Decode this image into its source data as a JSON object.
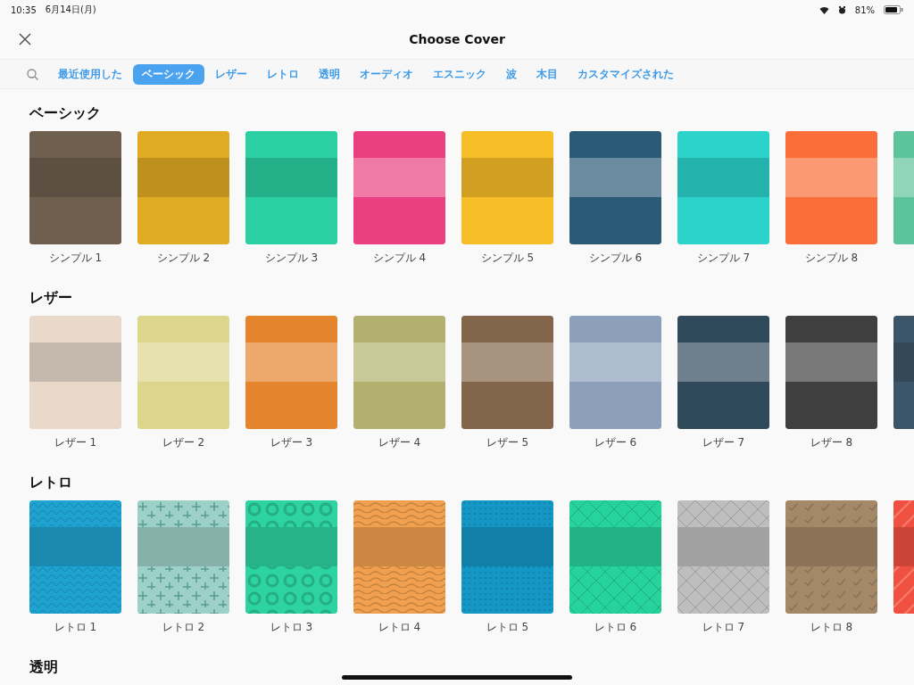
{
  "status_bar": {
    "time": "10:35",
    "date": "6月14日(月)",
    "battery": "81%"
  },
  "header": {
    "title": "Choose Cover"
  },
  "tabs": [
    {
      "label": "最近使用した",
      "selected": false
    },
    {
      "label": "ベーシック",
      "selected": true
    },
    {
      "label": "レザー",
      "selected": false
    },
    {
      "label": "レトロ",
      "selected": false
    },
    {
      "label": "透明",
      "selected": false
    },
    {
      "label": "オーディオ",
      "selected": false
    },
    {
      "label": "エスニック",
      "selected": false
    },
    {
      "label": "波",
      "selected": false
    },
    {
      "label": "木目",
      "selected": false
    },
    {
      "label": "カスタマイズされた",
      "selected": false
    }
  ],
  "sections": [
    {
      "title": "ベーシック",
      "covers": [
        {
          "label": "シンプル 1",
          "color": "#6e5f4f",
          "kind": "dark"
        },
        {
          "label": "シンプル 2",
          "color": "#e0ab24",
          "kind": "dark"
        },
        {
          "label": "シンプル 3",
          "color": "#2bd0a2",
          "kind": "dark"
        },
        {
          "label": "シンプル 4",
          "color": "#ea3f80",
          "kind": "light"
        },
        {
          "label": "シンプル 5",
          "color": "#f6bd26",
          "kind": "dark"
        },
        {
          "label": "シンプル 6",
          "color": "#2b5a77",
          "kind": "light"
        },
        {
          "label": "シンプル 7",
          "color": "#2bd3cb",
          "kind": "dark"
        },
        {
          "label": "シンプル 8",
          "color": "#fb6e3a",
          "kind": "light"
        },
        {
          "color": "#5dc39d",
          "kind": "light"
        }
      ]
    },
    {
      "title": "レザー",
      "covers": [
        {
          "label": "レザー 1",
          "color": "#e8d9ca",
          "kind": "dark"
        },
        {
          "label": "レザー 2",
          "color": "#dcd58c",
          "kind": "light"
        },
        {
          "label": "レザー 3",
          "color": "#e4842c",
          "kind": "light"
        },
        {
          "label": "レザー 4",
          "color": "#b1b06e",
          "kind": "light"
        },
        {
          "label": "レザー 5",
          "color": "#83654b",
          "kind": "light"
        },
        {
          "label": "レザー 6",
          "color": "#8c9fbb",
          "kind": "light"
        },
        {
          "label": "レザー 7",
          "color": "#304a5c",
          "kind": "light"
        },
        {
          "label": "レザー 8",
          "color": "#3f3f3f",
          "kind": "light"
        },
        {
          "color": "#3c5569",
          "kind": "dark"
        }
      ]
    },
    {
      "title": "レトロ",
      "covers": [
        {
          "label": "レトロ 1",
          "color": "#1ea2cf",
          "kind": "zigzag"
        },
        {
          "label": "レトロ 2",
          "color": "#9dd1c8",
          "kind": "plus"
        },
        {
          "label": "レトロ 3",
          "color": "#2dd3a0",
          "kind": "rings"
        },
        {
          "label": "レトロ 4",
          "color": "#f0a04e",
          "kind": "waves"
        },
        {
          "label": "レトロ 5",
          "color": "#1597c6",
          "kind": "dots"
        },
        {
          "label": "レトロ 6",
          "color": "#27d39d",
          "kind": "crosses"
        },
        {
          "label": "レトロ 7",
          "color": "#bebebe",
          "kind": "lattice"
        },
        {
          "label": "レトロ 8",
          "color": "#a58867",
          "kind": "checks"
        },
        {
          "color": "#f05040",
          "kind": "stripes"
        }
      ]
    },
    {
      "title": "透明"
    }
  ]
}
